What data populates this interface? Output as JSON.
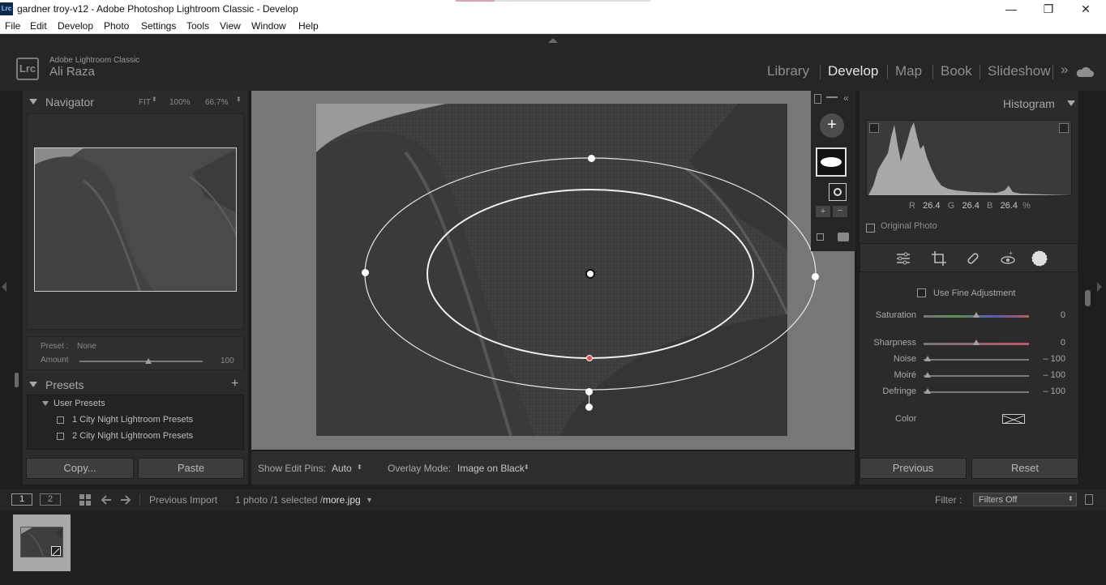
{
  "window": {
    "app_icon": "Lrc",
    "title": "gardner troy-v12 - Adobe Photoshop Lightroom Classic - Develop",
    "minimize": "—",
    "maximize": "❐",
    "close": "✕"
  },
  "menu": [
    "File",
    "Edit",
    "Develop",
    "Photo",
    "Settings",
    "Tools",
    "View",
    "Window",
    "Help"
  ],
  "identity": {
    "logo": "Lrc",
    "brand": "Adobe Lightroom Classic",
    "user": "Ali Raza"
  },
  "modules": {
    "items": [
      "Library",
      "Develop",
      "Map",
      "Book",
      "Slideshow"
    ],
    "active": "Develop",
    "more": "»"
  },
  "navigator": {
    "title": "Navigator",
    "fit": "FIT",
    "z1": "100%",
    "z2": "66.7%"
  },
  "preset_amount": {
    "preset_label": "Preset :",
    "preset_value": "None",
    "amount_label": "Amount",
    "amount_value": "100",
    "amount_level": 0.56
  },
  "presets": {
    "title": "Presets",
    "add": "+",
    "group": "User Presets",
    "items": [
      "1 City Night Lightroom Presets",
      "2 City Night Lightroom Presets"
    ]
  },
  "left_buttons": {
    "copy": "Copy...",
    "paste": "Paste"
  },
  "toolbar": {
    "edit_pins_label": "Show Edit Pins:",
    "edit_pins_value": "Auto",
    "overlay_label": "Overlay Mode:",
    "overlay_value": "Image on Black"
  },
  "histogram": {
    "title": "Histogram",
    "r_label": "R",
    "r": "26.4",
    "g_label": "G",
    "g": "26.4",
    "b_label": "B",
    "b": "26.4",
    "pct": "%",
    "original_photo": "Original Photo"
  },
  "adjust": {
    "fine_adjust": "Use Fine Adjustment",
    "sliders": [
      {
        "label": "Saturation",
        "value": "0",
        "level": 0.5
      },
      {
        "label": "Sharpness",
        "value": "0",
        "level": 0.5
      },
      {
        "label": "Noise",
        "value": "– 100",
        "level": 0
      },
      {
        "label": "Moiré",
        "value": "– 100",
        "level": 0
      },
      {
        "label": "Defringe",
        "value": "– 100",
        "level": 0
      }
    ],
    "color_label": "Color"
  },
  "right_buttons": {
    "previous": "Previous",
    "reset": "Reset"
  },
  "filmstrip": {
    "screen1": "1",
    "screen2": "2",
    "source": "Previous Import",
    "count": "1 photo /1 selected /",
    "file": "more.jpg",
    "filter_label": "Filter :",
    "filter_value": "Filters Off"
  },
  "colors": {
    "bg": "#1e1e1e",
    "panel": "#2b2b2b",
    "canvas": "#777777",
    "mask_pin_active": "#e05050"
  }
}
